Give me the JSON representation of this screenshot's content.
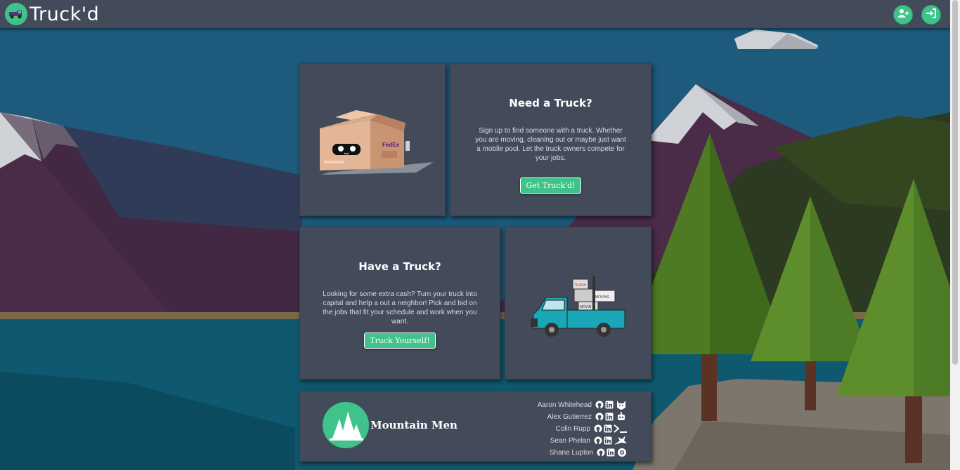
{
  "brand": {
    "name": "Truck'd"
  },
  "nav": {
    "signup_icon": "user-plus-icon",
    "login_icon": "sign-in-icon"
  },
  "colors": {
    "accent": "#3fc38a",
    "card": "#434a5a",
    "navbar": "#434a5a",
    "sky": "#1d5a7c"
  },
  "need_truck": {
    "title": "Need a Truck?",
    "body": "Sign up to find someone with a truck. Whether you are moving, cleaning out or maybe just want a mobile pool. Let the truck owners compete for your jobs.",
    "button": "Get Truck'd!"
  },
  "have_truck": {
    "title": "Have a Truck?",
    "body": "Looking for some extra cash? Turn your truck into capital and help a out a neighbor! Pick and bid on the jobs that fit your schedule and work when you want.",
    "button": "Truck Yourself!"
  },
  "box_illustration": {
    "label": "FedEx"
  },
  "truck_illustration": {
    "labels": [
      "TRASH",
      "MOVING",
      "MOVIN"
    ]
  },
  "footer": {
    "team_name": "Mountain Men",
    "members": [
      {
        "name": "Aaron Whitehead",
        "icons": [
          "github-icon",
          "linkedin-icon",
          "cat-icon"
        ]
      },
      {
        "name": "Alex Gutierrez",
        "icons": [
          "github-icon",
          "linkedin-icon",
          "robot-icon"
        ]
      },
      {
        "name": "Colin Rupp",
        "icons": [
          "github-icon",
          "linkedin-icon",
          "terminal-icon"
        ]
      },
      {
        "name": "Sean Phelan",
        "icons": [
          "github-icon",
          "linkedin-icon",
          "bird-icon"
        ]
      },
      {
        "name": "Shane Lupton",
        "icons": [
          "github-icon",
          "linkedin-icon",
          "camera-icon"
        ]
      }
    ]
  }
}
